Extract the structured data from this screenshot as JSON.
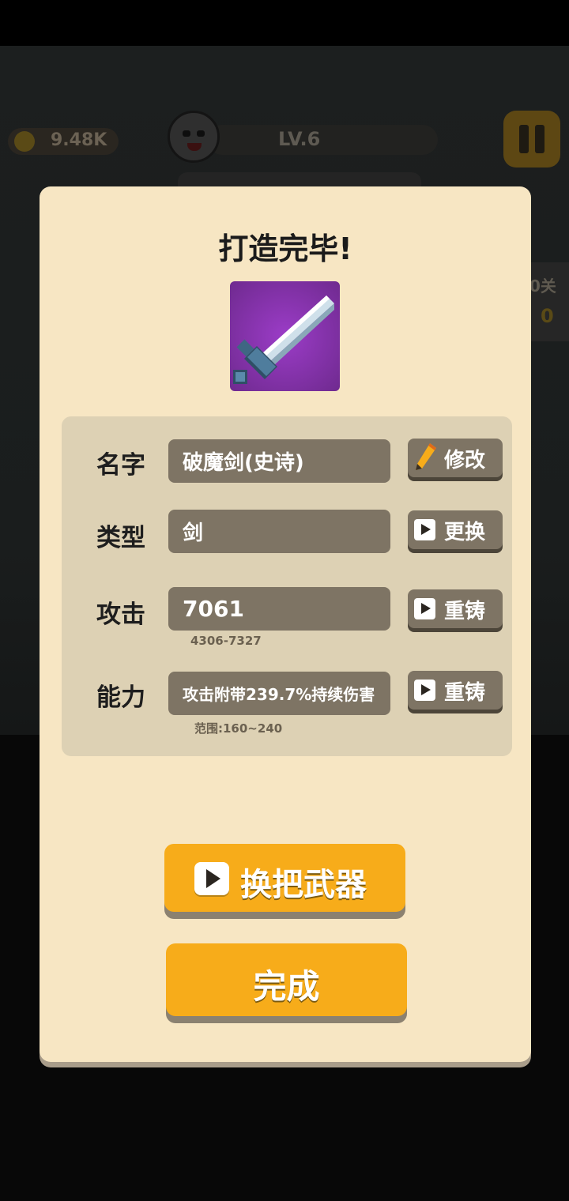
{
  "hud": {
    "coins": "9.48K",
    "level": "LV.6",
    "side_stage": "0关",
    "side_count": "0"
  },
  "dialog": {
    "title": "打造完毕!",
    "weapon_icon": "pixel-sword-icon",
    "weapon_bg_color": "#7a2fa0",
    "rows": [
      {
        "label": "名字",
        "value": "破魔剑(史诗)",
        "button": "修改",
        "button_icon": "pencil-icon",
        "hint": ""
      },
      {
        "label": "类型",
        "value": "剑",
        "button": "更换",
        "button_icon": "play-icon",
        "hint": ""
      },
      {
        "label": "攻击",
        "value": "7061",
        "button": "重铸",
        "button_icon": "play-icon",
        "hint": "4306-7327"
      },
      {
        "label": "能力",
        "value": "攻击附带239.7%持续伤害",
        "button": "重铸",
        "button_icon": "play-icon",
        "hint": "范围:160~240"
      }
    ],
    "swap_button": "换把武器",
    "done_button": "完成",
    "accent_color": "#f7ac1a",
    "panel_color": "#f7e6c3"
  }
}
